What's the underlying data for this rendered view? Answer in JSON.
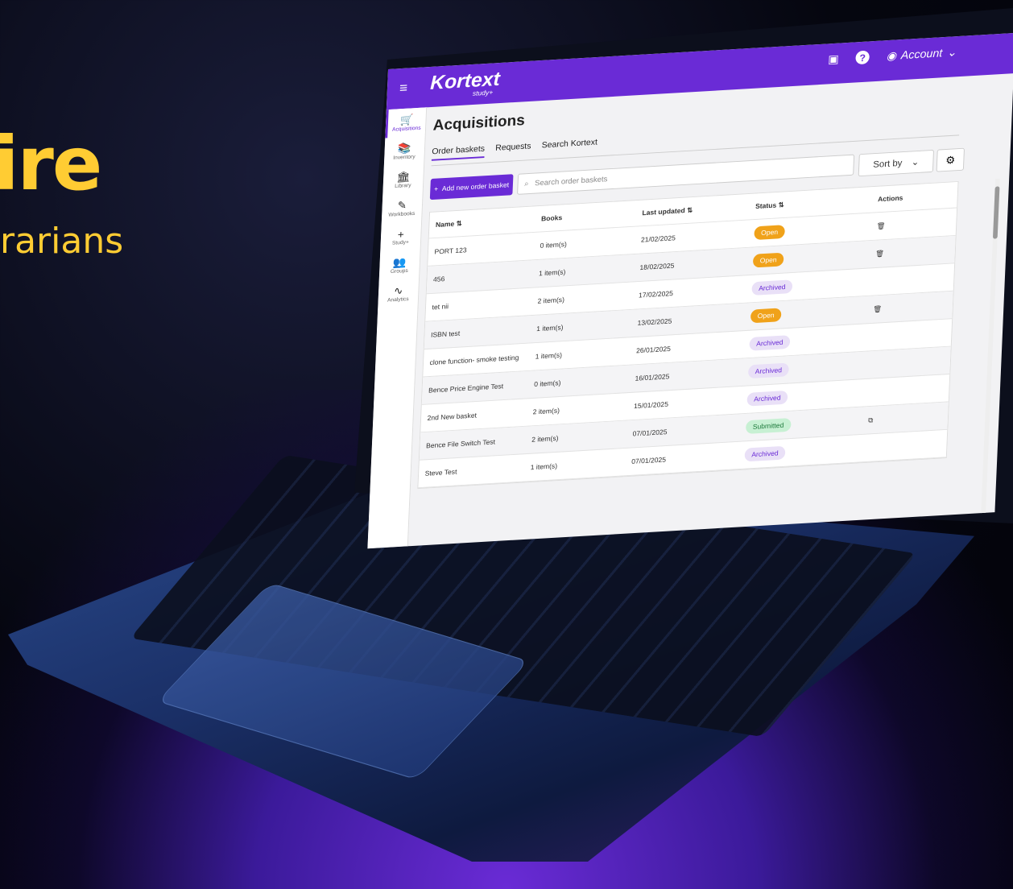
{
  "promo": {
    "headline": "ire",
    "subline": "rarians"
  },
  "topbar": {
    "brand": "Kortext",
    "brand_sub": "study+",
    "account_label": "Account"
  },
  "sidenav": [
    {
      "label": "Acquisitions",
      "icon": "basket-icon",
      "glyph": "🛒"
    },
    {
      "label": "Inventory",
      "icon": "books-icon",
      "glyph": "📚"
    },
    {
      "label": "Library",
      "icon": "library-icon",
      "glyph": "🏛"
    },
    {
      "label": "Workbooks",
      "icon": "workbook-icon",
      "glyph": "✎"
    },
    {
      "label": "Study+",
      "icon": "plus-icon",
      "glyph": "+"
    },
    {
      "label": "Groups",
      "icon": "groups-icon",
      "glyph": "👥"
    },
    {
      "label": "Analytics",
      "icon": "analytics-icon",
      "glyph": "∿"
    }
  ],
  "page": {
    "title": "Acquisitions",
    "tabs": [
      "Order baskets",
      "Requests",
      "Search Kortext"
    ],
    "add_button": "Add new order basket",
    "search_placeholder": "Search order baskets",
    "sort_label": "Sort by"
  },
  "table": {
    "headers": [
      "Name",
      "Books",
      "Last updated",
      "Status",
      "Actions"
    ],
    "rows": [
      {
        "name": "PORT 123",
        "books": "0 item(s)",
        "updated": "21/02/2025",
        "status": "Open",
        "action": "delete-icon"
      },
      {
        "name": "456",
        "books": "1 item(s)",
        "updated": "18/02/2025",
        "status": "Open",
        "action": "delete-icon"
      },
      {
        "name": "tet nii",
        "books": "2 item(s)",
        "updated": "17/02/2025",
        "status": "Archived",
        "action": ""
      },
      {
        "name": "ISBN test",
        "books": "1 item(s)",
        "updated": "13/02/2025",
        "status": "Open",
        "action": "delete-icon"
      },
      {
        "name": "clone function- smoke testing",
        "books": "1 item(s)",
        "updated": "26/01/2025",
        "status": "Archived",
        "action": ""
      },
      {
        "name": "Bence Price Engine Test",
        "books": "0 item(s)",
        "updated": "16/01/2025",
        "status": "Archived",
        "action": ""
      },
      {
        "name": "2nd New basket",
        "books": "2 item(s)",
        "updated": "15/01/2025",
        "status": "Archived",
        "action": ""
      },
      {
        "name": "Bence File Switch Test",
        "books": "2 item(s)",
        "updated": "07/01/2025",
        "status": "Submitted",
        "action": "copy-icon"
      },
      {
        "name": "Steve Test",
        "books": "1 item(s)",
        "updated": "07/01/2025",
        "status": "Archived",
        "action": ""
      }
    ]
  },
  "colors": {
    "brand": "#6a2bd6",
    "open": "#f0a21a",
    "archived_bg": "#e9e0f7",
    "submitted_bg": "#c7f0d3",
    "headline": "#ffcc33"
  }
}
